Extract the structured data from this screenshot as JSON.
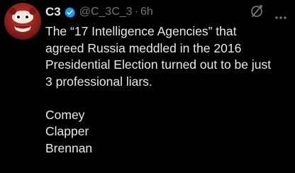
{
  "tweet": {
    "display_name": "C3",
    "handle": "@C_3C_3",
    "separator": "·",
    "time": "6h",
    "icons": {
      "verified": "verified-badge-icon",
      "grok": "grok-icon",
      "more": "more-options-icon"
    },
    "accent_color": "#1d9bf0",
    "text_lines": [
      "The “17 Intelligence Agencies” that",
      "agreed Russia meddled in the 2016",
      "Presidential Election turned out to be just",
      "3 professional liars."
    ],
    "names": [
      "Comey",
      "Clapper",
      "Brennan"
    ]
  }
}
